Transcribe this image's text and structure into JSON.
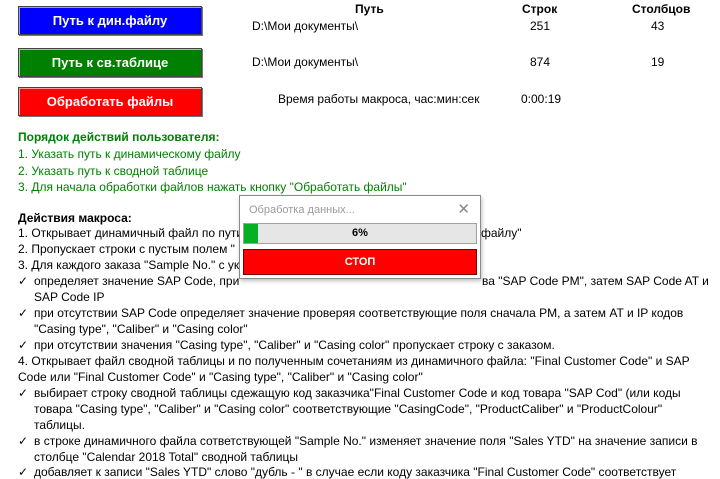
{
  "buttons": {
    "dyn_path": {
      "label": "Путь к дин.файлу",
      "color": "#0000ff"
    },
    "pivot_path": {
      "label": "Путь к св.таблице",
      "color": "#008000"
    },
    "process": {
      "label": "Обработать файлы",
      "color": "#ff0000"
    }
  },
  "table": {
    "headers": {
      "path": "Путь",
      "rows": "Строк",
      "cols": "Столбцов"
    },
    "dyn": {
      "path": "D:\\Мои документы\\",
      "rows": "251",
      "cols": "43"
    },
    "pivot": {
      "path": "D:\\Мои документы\\",
      "rows": "874",
      "cols": "19"
    },
    "runtime_label": "Время работы макроса, час:мин:сек",
    "runtime_value": "0:00:19"
  },
  "user_steps": {
    "title": "Порядок действий пользователя:",
    "items": [
      "1. Указать путь к динамическому файлу",
      "2. Указать путь к сводной таблице",
      "3. Для начала обработки файлов нажать кнопку \"Обработать файлы\""
    ]
  },
  "macro_actions": {
    "title": "Действия макроса:",
    "lines": [
      "1. Открывает динамичный файл по пути",
      "файлу\"",
      "2. Пропускает строки с пустым полем  \"",
      "3. Для каждого заказа \"Sample No.\" с ук",
      "определяет значение SAP Code, при",
      "ва \"SAP Code PM\", затем SAP   Code AT и",
      "SAP Code IP",
      "при отсутствии SAP Code определяет значение проверяя соответствующие поля сначала PM, а затем AT и IP кодов",
      "\"Casing type\", \"Caliber\" и \"Casing color\"",
      "при отсутствии значения \"Casing type\", \"Caliber\" и \"Casing color\" пропускает строку с заказом.",
      "4. Открывает файл сводной таблицы и по полученным сочетаниям из динамичного  файла: \"Final Customer Code\" и SAP",
      "Code или \"Final Customer Code\" и \"Casing type\", \"Caliber\" и \"Casing color\"",
      "выбирает строку сводной таблицы сдежащую код заказчика\"Final Customer Code и код товара \"SAP Cod\"  (или коды",
      "товара \"Casing type\", \"Caliber\" и \"Casing color\" соответствующие \"CasingCode\", \"ProductCaliber\" и \"ProductColour\"",
      "таблицы.",
      "в строке динамичного файла сответствующей \"Sample No.\" изменяет значение поля \"Sales YTD\" на значение записи в",
      "столбце \"Calendar 2018 Total\" сводной таблицы",
      "добавляет к записи \"Sales YTD\"  слово \"дубль - \" в случае если коду заказчика \"Final Customer Code\" соответствует"
    ],
    "check_glyph": "✓"
  },
  "dialog": {
    "title": "Обработка данных...",
    "close": "✕",
    "progress_text": "6%",
    "progress_value": 0.06,
    "progress_color": "#06b025",
    "stop_label": "СТОП"
  }
}
